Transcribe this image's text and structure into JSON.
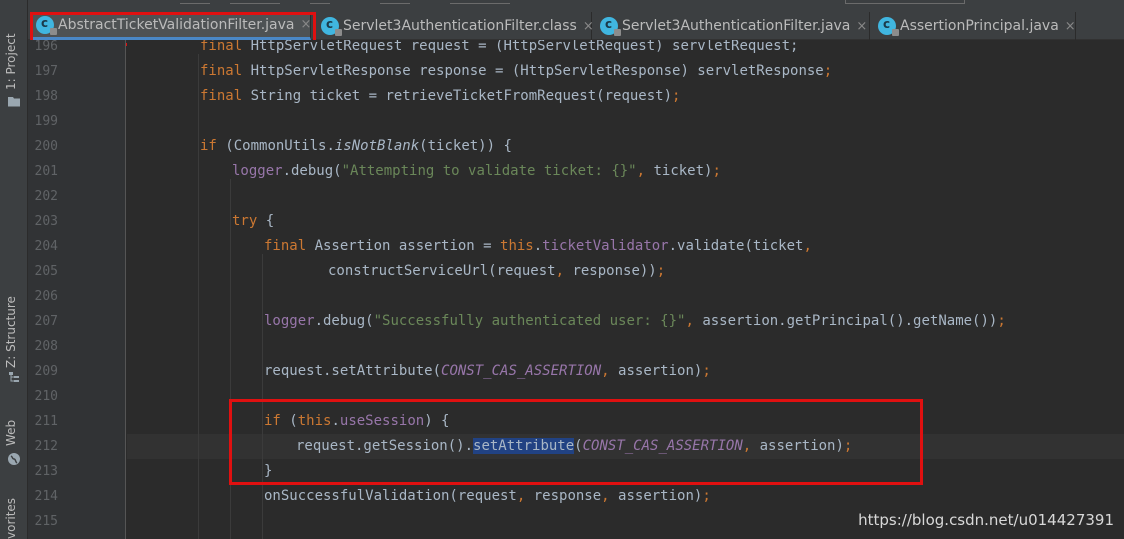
{
  "tabs": [
    {
      "label": "AbstractTicketValidationFilter.java",
      "close": "×",
      "active": true
    },
    {
      "label": "Servlet3AuthenticationFilter.class",
      "close": "×",
      "active": false
    },
    {
      "label": "Servlet3AuthenticationFilter.java",
      "close": "×",
      "active": false
    },
    {
      "label": "AssertionPrincipal.java",
      "close": "×",
      "active": false
    }
  ],
  "tool_windows": {
    "project": "1: Project",
    "structure": "Z: Structure",
    "web": "Web",
    "favorites": "vorites"
  },
  "line_numbers": [
    "196",
    "197",
    "198",
    "199",
    "200",
    "201",
    "202",
    "203",
    "204",
    "205",
    "206",
    "207",
    "208",
    "209",
    "210",
    "211",
    "212",
    "213",
    "214",
    "215"
  ],
  "code_lines": [
    {
      "parts": [
        [
          "k",
          "final "
        ],
        [
          "m",
          "HttpServletRequest request = (HttpServletRequest) servletRequest;"
        ]
      ]
    },
    {
      "parts": [
        [
          "k",
          "final "
        ],
        [
          "m",
          "HttpServletResponse response = (HttpServletResponse) servletResponse"
        ],
        [
          "k",
          ";"
        ]
      ]
    },
    {
      "parts": [
        [
          "k",
          "final "
        ],
        [
          "m",
          "String ticket = retrieveTicketFromRequest(request)"
        ],
        [
          "k",
          ";"
        ]
      ]
    },
    {
      "parts": []
    },
    {
      "parts": [
        [
          "k",
          "if "
        ],
        [
          "m",
          "(CommonUtils."
        ],
        [
          "mi",
          "isNotBlank"
        ],
        [
          "m",
          "(ticket)) {"
        ]
      ]
    },
    {
      "parts": [
        [
          "f",
          "logger"
        ],
        [
          "m",
          ".debug("
        ],
        [
          "s",
          "\"Attempting to validate ticket: {}\""
        ],
        [
          "k",
          ", "
        ],
        [
          "m",
          "ticket)"
        ],
        [
          "k",
          ";"
        ]
      ]
    },
    {
      "parts": []
    },
    {
      "parts": [
        [
          "k",
          "try "
        ],
        [
          "m",
          "{"
        ]
      ]
    },
    {
      "parts": [
        [
          "k",
          "final "
        ],
        [
          "m",
          "Assertion assertion = "
        ],
        [
          "k",
          "this"
        ],
        [
          "m",
          "."
        ],
        [
          "f",
          "ticketValidator"
        ],
        [
          "m",
          ".validate(ticket"
        ],
        [
          "k",
          ","
        ]
      ]
    },
    {
      "parts": [
        [
          "m",
          "constructServiceUrl(request"
        ],
        [
          "k",
          ", "
        ],
        [
          "m",
          "response))"
        ],
        [
          "k",
          ";"
        ]
      ]
    },
    {
      "parts": []
    },
    {
      "parts": [
        [
          "f",
          "logger"
        ],
        [
          "m",
          ".debug("
        ],
        [
          "s",
          "\"Successfully authenticated user: {}\""
        ],
        [
          "k",
          ", "
        ],
        [
          "m",
          "assertion.getPrincipal().getName())"
        ],
        [
          "k",
          ";"
        ]
      ]
    },
    {
      "parts": []
    },
    {
      "parts": [
        [
          "m",
          "request.setAttribute("
        ],
        [
          "fi",
          "CONST_CAS_ASSERTION"
        ],
        [
          "k",
          ", "
        ],
        [
          "m",
          "assertion)"
        ],
        [
          "k",
          ";"
        ]
      ]
    },
    {
      "parts": []
    },
    {
      "parts": [
        [
          "k",
          "if "
        ],
        [
          "m",
          "("
        ],
        [
          "k",
          "this"
        ],
        [
          "m",
          "."
        ],
        [
          "f",
          "useSession"
        ],
        [
          "m",
          ") {"
        ]
      ]
    },
    {
      "parts": [
        [
          "m",
          "request.getSession()."
        ],
        [
          "sel",
          "setAttribute"
        ],
        [
          "m",
          "("
        ],
        [
          "fi",
          "CONST_CAS_ASSERTION"
        ],
        [
          "k",
          ", "
        ],
        [
          "m",
          "assertion)"
        ],
        [
          "k",
          ";"
        ]
      ]
    },
    {
      "parts": [
        [
          "m",
          "}"
        ]
      ]
    },
    {
      "parts": [
        [
          "m",
          "onSuccessfulValidation(request"
        ],
        [
          "k",
          ", "
        ],
        [
          "m",
          "response"
        ],
        [
          "k",
          ", "
        ],
        [
          "m",
          "assertion)"
        ],
        [
          "k",
          ";"
        ]
      ]
    },
    {
      "parts": []
    }
  ],
  "watermark": "https://blog.csdn.net/u014427391",
  "colors": {
    "keyword": "#cc7832",
    "field": "#9876aa",
    "string": "#6a8759",
    "text": "#a9b7c6",
    "highlight_box": "#e01010"
  }
}
